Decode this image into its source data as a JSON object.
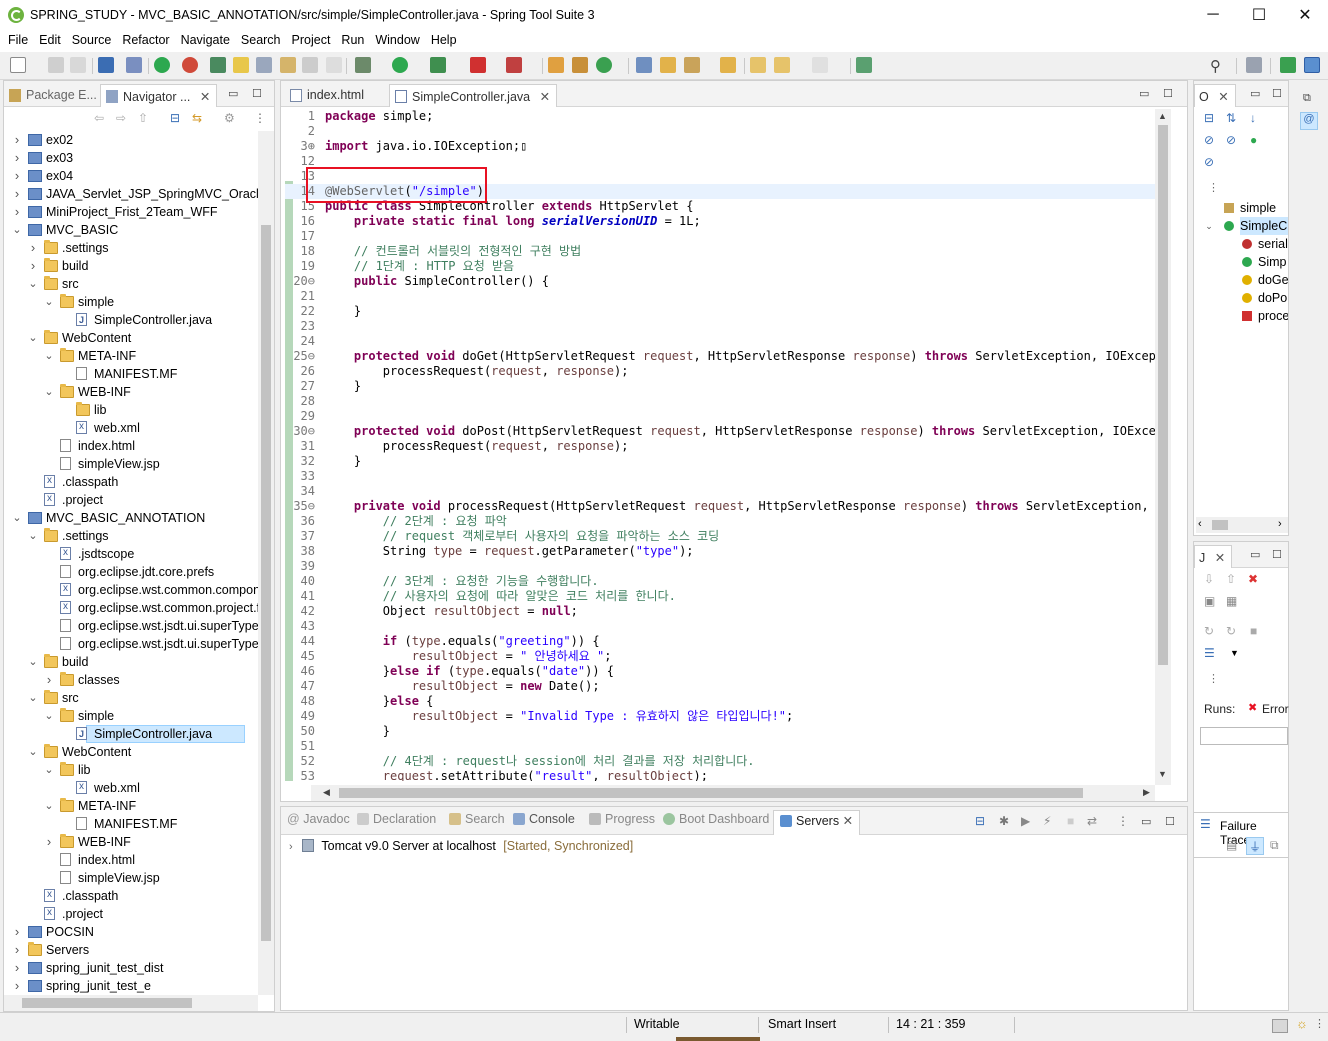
{
  "window": {
    "title": "SPRING_STUDY - MVC_BASIC_ANNOTATION/src/simple/SimpleController.java - Spring Tool Suite 3",
    "minimize": "─",
    "maximize": "☐",
    "close": "✕"
  },
  "menu": [
    "File",
    "Edit",
    "Source",
    "Refactor",
    "Navigate",
    "Search",
    "Project",
    "Run",
    "Window",
    "Help"
  ],
  "left_panel": {
    "tabs": [
      {
        "label": "Package E...",
        "icon": "package-explorer-icon"
      },
      {
        "label": "Navigator ...",
        "icon": "navigator-icon"
      }
    ],
    "tree": [
      {
        "label": "ex02",
        "depth": 0,
        "twisty": "›",
        "icon": "proj"
      },
      {
        "label": "ex03",
        "depth": 0,
        "twisty": "›",
        "icon": "proj"
      },
      {
        "label": "ex04",
        "depth": 0,
        "twisty": "›",
        "icon": "proj"
      },
      {
        "label": "JAVA_Servlet_JSP_SpringMVC_OracleDB",
        "depth": 0,
        "twisty": "›",
        "icon": "proj"
      },
      {
        "label": "MiniProject_Frist_2Team_WFF",
        "depth": 0,
        "twisty": "›",
        "icon": "proj"
      },
      {
        "label": "MVC_BASIC",
        "depth": 0,
        "twisty": "⌄",
        "icon": "proj"
      },
      {
        "label": ".settings",
        "depth": 1,
        "twisty": "›",
        "icon": "folder"
      },
      {
        "label": "build",
        "depth": 1,
        "twisty": "›",
        "icon": "folder"
      },
      {
        "label": "src",
        "depth": 1,
        "twisty": "⌄",
        "icon": "folder"
      },
      {
        "label": "simple",
        "depth": 2,
        "twisty": "⌄",
        "icon": "folder"
      },
      {
        "label": "SimpleController.java",
        "depth": 3,
        "twisty": "",
        "icon": "java"
      },
      {
        "label": "WebContent",
        "depth": 1,
        "twisty": "⌄",
        "icon": "folder"
      },
      {
        "label": "META-INF",
        "depth": 2,
        "twisty": "⌄",
        "icon": "folder"
      },
      {
        "label": "MANIFEST.MF",
        "depth": 3,
        "twisty": "",
        "icon": "file"
      },
      {
        "label": "WEB-INF",
        "depth": 2,
        "twisty": "⌄",
        "icon": "folder"
      },
      {
        "label": "lib",
        "depth": 3,
        "twisty": "",
        "icon": "folder"
      },
      {
        "label": "web.xml",
        "depth": 3,
        "twisty": "",
        "icon": "xml"
      },
      {
        "label": "index.html",
        "depth": 2,
        "twisty": "",
        "icon": "file"
      },
      {
        "label": "simpleView.jsp",
        "depth": 2,
        "twisty": "",
        "icon": "file"
      },
      {
        "label": ".classpath",
        "depth": 1,
        "twisty": "",
        "icon": "xml"
      },
      {
        "label": ".project",
        "depth": 1,
        "twisty": "",
        "icon": "xml"
      },
      {
        "label": "MVC_BASIC_ANNOTATION",
        "depth": 0,
        "twisty": "⌄",
        "icon": "proj"
      },
      {
        "label": ".settings",
        "depth": 1,
        "twisty": "⌄",
        "icon": "folder"
      },
      {
        "label": ".jsdtscope",
        "depth": 2,
        "twisty": "",
        "icon": "xml"
      },
      {
        "label": "org.eclipse.jdt.core.prefs",
        "depth": 2,
        "twisty": "",
        "icon": "file"
      },
      {
        "label": "org.eclipse.wst.common.component",
        "depth": 2,
        "twisty": "",
        "icon": "xml"
      },
      {
        "label": "org.eclipse.wst.common.project.facet",
        "depth": 2,
        "twisty": "",
        "icon": "xml"
      },
      {
        "label": "org.eclipse.wst.jsdt.ui.superType.container",
        "depth": 2,
        "twisty": "",
        "icon": "file"
      },
      {
        "label": "org.eclipse.wst.jsdt.ui.superType.name",
        "depth": 2,
        "twisty": "",
        "icon": "file"
      },
      {
        "label": "build",
        "depth": 1,
        "twisty": "⌄",
        "icon": "folder"
      },
      {
        "label": "classes",
        "depth": 2,
        "twisty": "›",
        "icon": "folder"
      },
      {
        "label": "src",
        "depth": 1,
        "twisty": "⌄",
        "icon": "folder"
      },
      {
        "label": "simple",
        "depth": 2,
        "twisty": "⌄",
        "icon": "folder"
      },
      {
        "label": "SimpleController.java",
        "depth": 3,
        "twisty": "",
        "icon": "java",
        "selected": true
      },
      {
        "label": "WebContent",
        "depth": 1,
        "twisty": "⌄",
        "icon": "folder"
      },
      {
        "label": "lib",
        "depth": 2,
        "twisty": "⌄",
        "icon": "folder"
      },
      {
        "label": "web.xml",
        "depth": 3,
        "twisty": "",
        "icon": "xml"
      },
      {
        "label": "META-INF",
        "depth": 2,
        "twisty": "⌄",
        "icon": "folder"
      },
      {
        "label": "MANIFEST.MF",
        "depth": 3,
        "twisty": "",
        "icon": "file"
      },
      {
        "label": "WEB-INF",
        "depth": 2,
        "twisty": "›",
        "icon": "folder"
      },
      {
        "label": "index.html",
        "depth": 2,
        "twisty": "",
        "icon": "file"
      },
      {
        "label": "simpleView.jsp",
        "depth": 2,
        "twisty": "",
        "icon": "file"
      },
      {
        "label": ".classpath",
        "depth": 1,
        "twisty": "",
        "icon": "xml"
      },
      {
        "label": ".project",
        "depth": 1,
        "twisty": "",
        "icon": "xml"
      },
      {
        "label": "POCSIN",
        "depth": 0,
        "twisty": "›",
        "icon": "proj"
      },
      {
        "label": "Servers",
        "depth": 0,
        "twisty": "›",
        "icon": "folder"
      },
      {
        "label": "spring_junit_test_dist",
        "depth": 0,
        "twisty": "›",
        "icon": "proj"
      },
      {
        "label": "spring_junit_test_e",
        "depth": 0,
        "twisty": "›",
        "icon": "proj"
      }
    ]
  },
  "editor": {
    "tabs": [
      {
        "label": "index.html",
        "icon": "html-file-icon"
      },
      {
        "label": "SimpleController.java",
        "icon": "java-file-icon",
        "active": true
      }
    ],
    "lines": [
      {
        "n": "1",
        "html": "<span class=\"kw\">package</span> simple;"
      },
      {
        "n": "2",
        "html": ""
      },
      {
        "n": "3⊕",
        "html": "<span class=\"kw\">import</span> java.io.IOException;▯"
      },
      {
        "n": "12",
        "html": ""
      },
      {
        "n": "13",
        "html": ""
      },
      {
        "n": "14",
        "html": "<span class=\"an\">@WebServlet</span>(<span class=\"str\">\"/simple\"</span>)",
        "current": true
      },
      {
        "n": "15",
        "html": "<span class=\"kw\">public class</span> SimpleController <span class=\"kw\">extends</span> HttpServlet {"
      },
      {
        "n": "16",
        "html": "    <span class=\"kw\">private static final long</span> <span class=\"fld\">serialVersionUID</span> = 1L;"
      },
      {
        "n": "17",
        "html": ""
      },
      {
        "n": "18",
        "html": "    <span class=\"cm\">// 컨트롤러 서블릿의 전형적인 구현 방법</span>"
      },
      {
        "n": "19",
        "html": "    <span class=\"cm\">// 1단계 : HTTP 요청 받음</span>"
      },
      {
        "n": "20⊖",
        "html": "    <span class=\"kw\">public</span> SimpleController() {"
      },
      {
        "n": "21",
        "html": ""
      },
      {
        "n": "22",
        "html": "    }"
      },
      {
        "n": "23",
        "html": ""
      },
      {
        "n": "24",
        "html": ""
      },
      {
        "n": "25⊖",
        "html": "    <span class=\"kw\">protected void</span> doGet(HttpServletRequest <span class=\"prm\">request</span>, HttpServletResponse <span class=\"prm\">response</span>) <span class=\"kw\">throws</span> ServletException, IOException"
      },
      {
        "n": "26",
        "html": "        processRequest(<span class=\"prm\">request</span>, <span class=\"prm\">response</span>);"
      },
      {
        "n": "27",
        "html": "    }"
      },
      {
        "n": "28",
        "html": ""
      },
      {
        "n": "29",
        "html": ""
      },
      {
        "n": "30⊖",
        "html": "    <span class=\"kw\">protected void</span> doPost(HttpServletRequest <span class=\"prm\">request</span>, HttpServletResponse <span class=\"prm\">response</span>) <span class=\"kw\">throws</span> ServletException, IOExceptio"
      },
      {
        "n": "31",
        "html": "        processRequest(<span class=\"prm\">request</span>, <span class=\"prm\">response</span>);"
      },
      {
        "n": "32",
        "html": "    }"
      },
      {
        "n": "33",
        "html": ""
      },
      {
        "n": "34",
        "html": ""
      },
      {
        "n": "35⊖",
        "html": "    <span class=\"kw\">private void</span> processRequest(HttpServletRequest <span class=\"prm\">request</span>, HttpServletResponse <span class=\"prm\">response</span>) <span class=\"kw\">throws</span> ServletException, IOEx"
      },
      {
        "n": "36",
        "html": "        <span class=\"cm\">// 2단계 : 요청 파악</span>"
      },
      {
        "n": "37",
        "html": "        <span class=\"cm\">// request 객체로부터 사용자의 요청을 파악하는 소스 코딩</span>"
      },
      {
        "n": "38",
        "html": "        String <span class=\"prm\">type</span> = <span class=\"prm\">request</span>.getParameter(<span class=\"str\">\"type\"</span>);"
      },
      {
        "n": "39",
        "html": ""
      },
      {
        "n": "40",
        "html": "        <span class=\"cm\">// 3단계 : 요청한 기능을 수행합니다.</span>"
      },
      {
        "n": "41",
        "html": "        <span class=\"cm\">// 사용자의 요청에 따라 알맞은 코드 처리를 한니다.</span>"
      },
      {
        "n": "42",
        "html": "        Object <span class=\"prm\">resultObject</span> = <span class=\"kw\">null</span>;"
      },
      {
        "n": "43",
        "html": ""
      },
      {
        "n": "44",
        "html": "        <span class=\"kw\">if</span> (<span class=\"prm\">type</span>.equals(<span class=\"str\">\"greeting\"</span>)) {"
      },
      {
        "n": "45",
        "html": "            <span class=\"prm\">resultObject</span> = <span class=\"str\">\" 안녕하세요 \"</span>;"
      },
      {
        "n": "46",
        "html": "        }<span class=\"kw\">else if</span> (<span class=\"prm\">type</span>.equals(<span class=\"str\">\"date\"</span>)) {"
      },
      {
        "n": "47",
        "html": "            <span class=\"prm\">resultObject</span> = <span class=\"kw\">new</span> Date();"
      },
      {
        "n": "48",
        "html": "        }<span class=\"kw\">else</span> {"
      },
      {
        "n": "49",
        "html": "            <span class=\"prm\">resultObject</span> = <span class=\"str\">\"Invalid Type : 유효하지 않은 타입입니다!\"</span>;"
      },
      {
        "n": "50",
        "html": "        }"
      },
      {
        "n": "51",
        "html": ""
      },
      {
        "n": "52",
        "html": "        <span class=\"cm\">// 4단계 : request나 session에 처리 결과를 저장 처리합니다.</span>"
      },
      {
        "n": "53",
        "html": "        <span class=\"prm\">request</span>.setAttribute(<span class=\"str\">\"result\"</span>, <span class=\"prm\">resultObject</span>);"
      }
    ]
  },
  "outline": {
    "tab": "O",
    "items": [
      {
        "label": "simple",
        "icon": "package-icon"
      },
      {
        "label": "SimpleC",
        "icon": "class-icon",
        "selected": true
      },
      {
        "label": "serial",
        "icon": "field-icon"
      },
      {
        "label": "Simp",
        "icon": "constructor-icon"
      },
      {
        "label": "doGe",
        "icon": "method-icon"
      },
      {
        "label": "doPo",
        "icon": "method-icon"
      },
      {
        "label": "proce",
        "icon": "private-method-icon"
      }
    ]
  },
  "junit": {
    "tab": "J",
    "runs_label": "Runs:",
    "error_label": "Error",
    "failure_trace": "Failure Trace"
  },
  "bottom": {
    "tabs": [
      "Javadoc",
      "Declaration",
      "Search",
      "Console",
      "Progress",
      "Boot Dashboard",
      "Servers"
    ],
    "server_name": "Tomcat v9.0 Server at localhost",
    "server_state": "[Started, Synchronized]"
  },
  "status": {
    "writable": "Writable",
    "insert_mode": "Smart Insert",
    "position": "14 : 21 : 359"
  },
  "colors": {
    "accent": "#e81123",
    "selection": "#cce8ff",
    "current_line": "#e8f2fe"
  }
}
